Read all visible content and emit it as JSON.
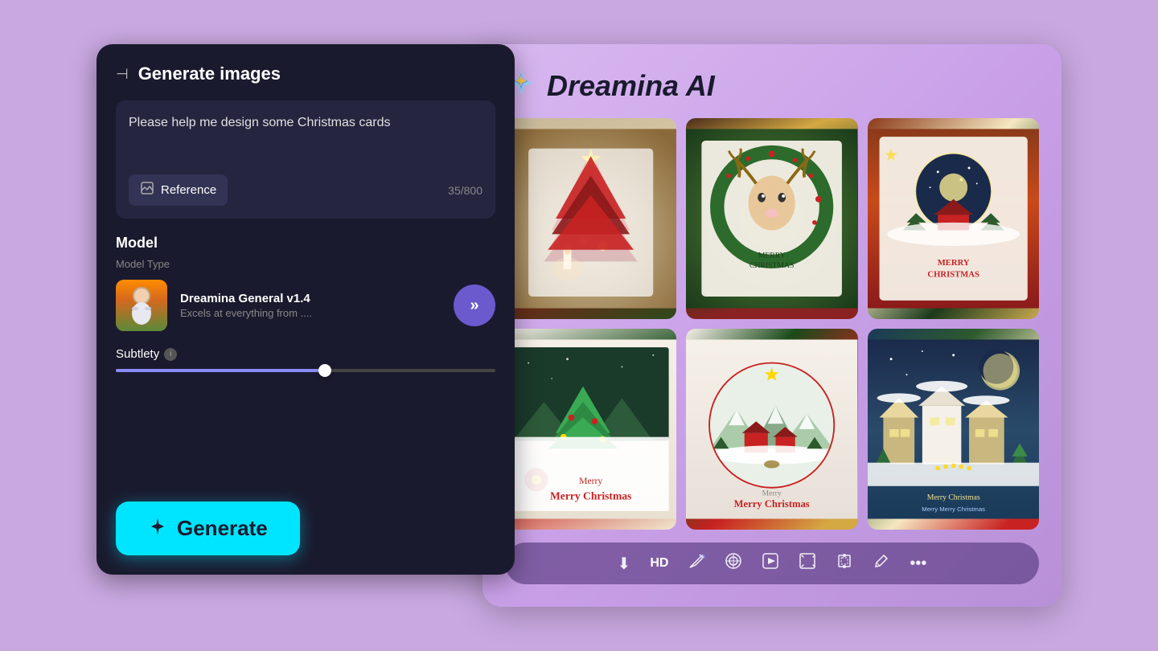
{
  "app": {
    "title": "Dreamina AI",
    "logo": "✦"
  },
  "left_panel": {
    "header": {
      "sidebar_icon": "⊣",
      "title": "Generate images"
    },
    "prompt": {
      "text": "Please help me design some Christmas cards",
      "char_count": "35/800"
    },
    "reference_button": {
      "label": "Reference",
      "icon": "⊞"
    },
    "model_section": {
      "label": "Model",
      "type_label": "Model Type",
      "model_name": "Dreamina General v1.4",
      "model_desc": "Excels at everything from ...."
    },
    "subtlety_section": {
      "label": "Subtlety",
      "slider_value": 55
    }
  },
  "generate_button": {
    "label": "Generate",
    "icon": "✦"
  },
  "right_panel": {
    "title": "Dreamina AI",
    "logo": "✦",
    "images": [
      {
        "id": 1,
        "alt": "Christmas tree card with ornaments"
      },
      {
        "id": 2,
        "alt": "Reindeer Christmas card"
      },
      {
        "id": 3,
        "alt": "Winter scene Christmas card"
      },
      {
        "id": 4,
        "alt": "3D pop-up Christmas tree card"
      },
      {
        "id": 5,
        "alt": "Merry Christmas scene card"
      },
      {
        "id": 6,
        "alt": "Winter village pop-up card"
      }
    ],
    "toolbar": {
      "items": [
        {
          "icon": "⬇",
          "label": "download"
        },
        {
          "icon": "HD",
          "label": "hd"
        },
        {
          "icon": "✏",
          "label": "edit"
        },
        {
          "icon": "✂",
          "label": "magic-eraser"
        },
        {
          "icon": "▷",
          "label": "play"
        },
        {
          "icon": "⬜",
          "label": "expand"
        },
        {
          "icon": "⊞",
          "label": "crop"
        },
        {
          "icon": "✎",
          "label": "annotate"
        },
        {
          "icon": "…",
          "label": "more"
        }
      ]
    }
  }
}
